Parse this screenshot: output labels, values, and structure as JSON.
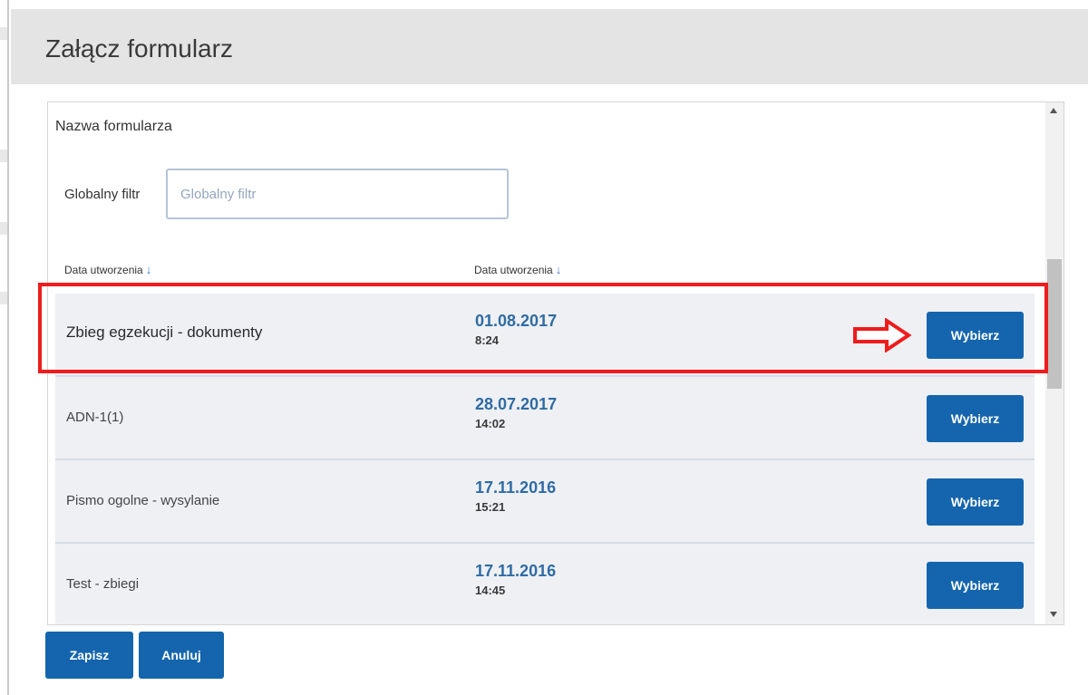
{
  "modal": {
    "title": "Załącz formularz"
  },
  "panel": {
    "section_title": "Nazwa formularza",
    "filter": {
      "label": "Globalny filtr",
      "placeholder": "Globalny filtr",
      "value": ""
    },
    "columns": [
      {
        "label": "Data utworzenia",
        "sort_icon": "arrow-down-icon"
      },
      {
        "label": "Data utworzenia",
        "sort_icon": "arrow-down-icon"
      }
    ],
    "rows": [
      {
        "name": "Zbieg egzekucji - dokumenty",
        "date": "01.08.2017",
        "time": "8:24",
        "button": "Wybierz"
      },
      {
        "name": "ADN-1(1)",
        "date": "28.07.2017",
        "time": "14:02",
        "button": "Wybierz"
      },
      {
        "name": "Pismo ogolne - wysylanie",
        "date": "17.11.2016",
        "time": "15:21",
        "button": "Wybierz"
      },
      {
        "name": "Test - zbiegi",
        "date": "17.11.2016",
        "time": "14:45",
        "button": "Wybierz"
      }
    ]
  },
  "footer": {
    "save_label": "Zapisz",
    "cancel_label": "Anuluj"
  },
  "colors": {
    "accent": "#1465ad",
    "date": "#2f6ca3",
    "highlight": "#ee1c1c",
    "header_bg": "#e4e4e4",
    "row_bg": "#eef0f4"
  }
}
